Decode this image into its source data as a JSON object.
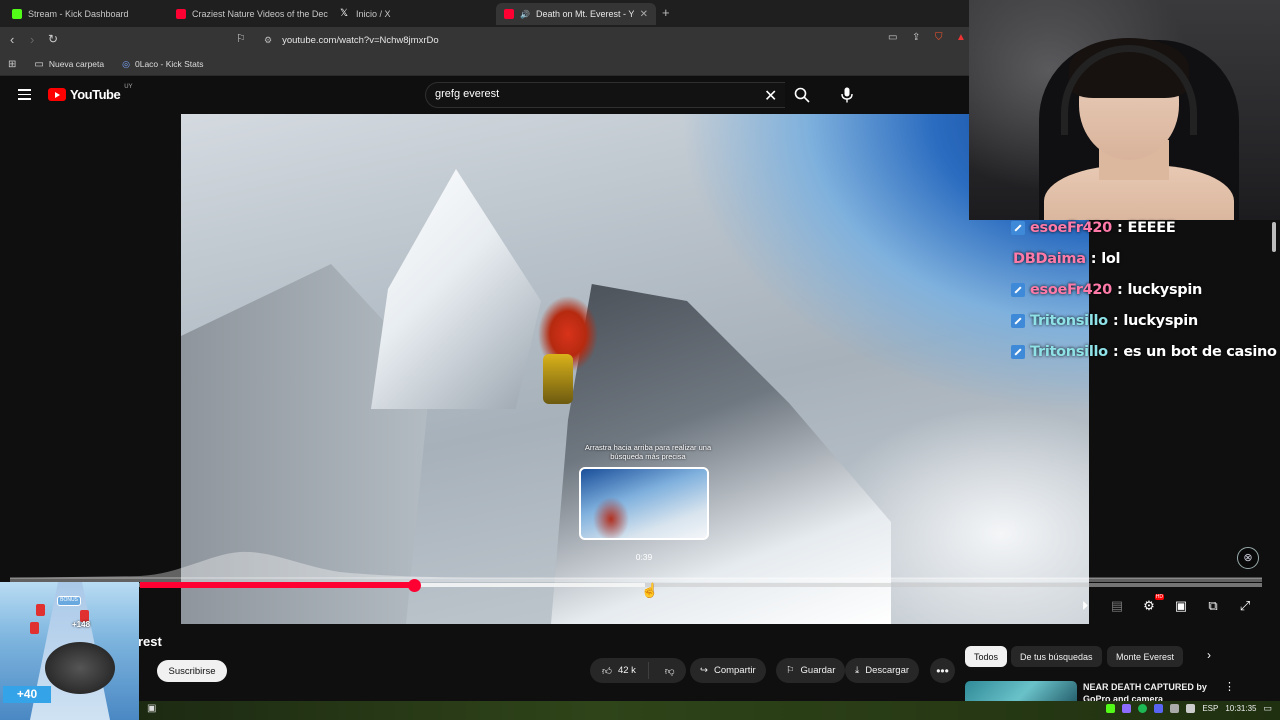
{
  "browser": {
    "tabs": [
      {
        "title": "Stream - Kick Dashboard",
        "color": "#53fc18",
        "active": false
      },
      {
        "title": "Craziest Nature Videos of the Decade",
        "color": "#ff0033",
        "active": false
      },
      {
        "title": "Inicio / X",
        "color": "#ffffff",
        "active": false
      },
      {
        "title": "Death on Mt. Everest - YouTube",
        "color": "#ff0033",
        "active": true
      }
    ],
    "new_tab_icon": "plus-icon",
    "url": "youtube.com/watch?v=Nchw8jmxrDo",
    "bookmarks": [
      {
        "label": "Nueva carpeta",
        "icon": "folder-icon"
      },
      {
        "label": "0Laco - Kick Stats",
        "icon": "globe-icon"
      }
    ]
  },
  "youtube": {
    "logo_text": "YouTube",
    "country_code": "UY",
    "search_query": "grefg everest",
    "player": {
      "seek_hint": "Arrastra hacia arriba para realizar una búsqueda más precisa",
      "preview_time": "0:39",
      "progress_played_fraction": 0.219,
      "progress_hover_fraction": 0.403
    },
    "title_fragment": "rest",
    "subscribe_label": "Suscribirse",
    "actions": {
      "likes": "42 k",
      "share": "Compartir",
      "save": "Guardar",
      "download": "Descargar"
    },
    "chips": [
      {
        "label": "Todos",
        "active": true
      },
      {
        "label": "De tus búsquedas",
        "active": false
      },
      {
        "label": "Monte Everest",
        "active": false
      }
    ],
    "recommended": [
      {
        "title": "NEAR DEATH CAPTURED by GoPro and camera"
      }
    ]
  },
  "game": {
    "gate_label": "BONUS",
    "score": "+148",
    "bonus": "+40"
  },
  "chat": [
    {
      "user": "esoeFr420",
      "message": "EEEEE",
      "color": "#ff7aa8",
      "badge": true
    },
    {
      "user": "DBDaima",
      "message": "lol",
      "color": "#ff7aa8",
      "badge": false
    },
    {
      "user": "esoeFr420",
      "message": "luckyspin",
      "color": "#ff7aa8",
      "badge": true
    },
    {
      "user": "Tritonsillo",
      "message": "luckyspin",
      "color": "#8fe3e8",
      "badge": true
    },
    {
      "user": "Tritonsillo",
      "message": "es un bot de casino",
      "color": "#8fe3e8",
      "badge": true
    }
  ],
  "taskbar": {
    "language": "ESP",
    "time": "10:31:35"
  },
  "colors": {
    "youtube_red": "#ff0033",
    "background": "#0f0f0f",
    "chip_bg": "#272727"
  }
}
